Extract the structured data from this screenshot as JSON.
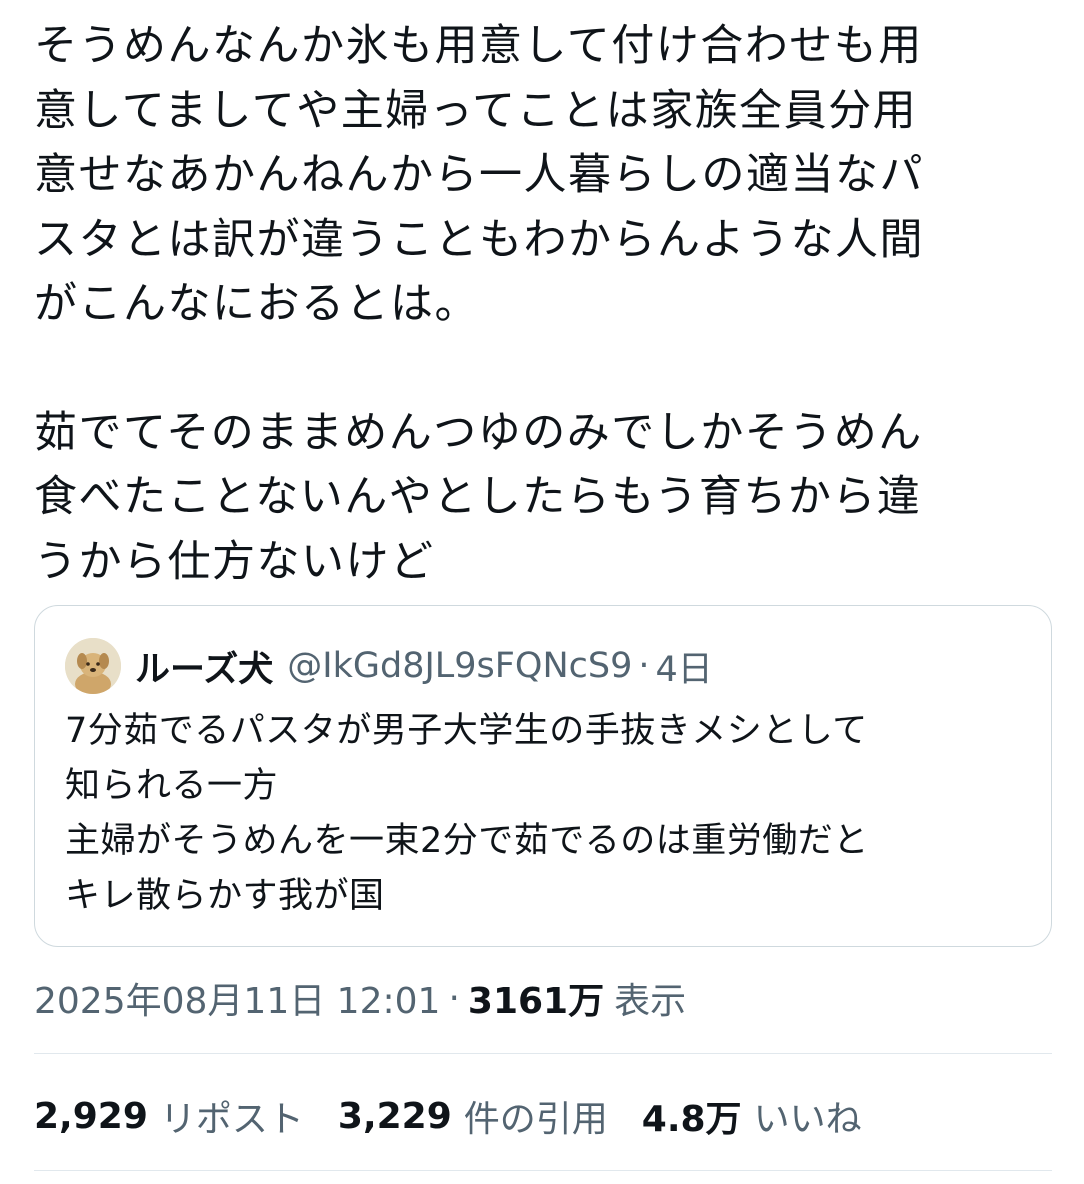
{
  "tweet": {
    "paragraph1": [
      "そうめんなんか氷も用意して付け合わせも用",
      "意してましてや主婦ってことは家族全員分用",
      "意せなあかんねんから一人暮らしの適当なパ",
      "スタとは訳が違うこともわからんような人間",
      "がこんなにおるとは。"
    ],
    "paragraph2": [
      "茹でてそのままめんつゆのみでしかそうめん",
      "食べたことないんやとしたらもう育ちから違",
      "うから仕方ないけど"
    ]
  },
  "quote": {
    "name": "ルーズ犬",
    "handle": "@IkGd8JL9sFQNcS9",
    "separator": "·",
    "time": "4日",
    "lines": [
      "7分茹でるパスタが男子大学生の手抜きメシとして",
      "知られる一方",
      "主婦がそうめんを一束2分で茹でるのは重労働だと",
      "キレ散らかす我が国"
    ]
  },
  "meta": {
    "datetime": "2025年08月11日 12:01",
    "separator": "·",
    "views_count": "3161万",
    "views_label": "表示"
  },
  "stats": {
    "reposts_count": "2,929",
    "reposts_label": "リポスト",
    "quotes_count": "3,229",
    "quotes_label": "件の引用",
    "likes_count": "4.8万",
    "likes_label": "いいね"
  },
  "colors": {
    "text": "#0f1419",
    "secondary": "#536471",
    "border": "#cfd9de",
    "divider": "#e1e8ed"
  }
}
